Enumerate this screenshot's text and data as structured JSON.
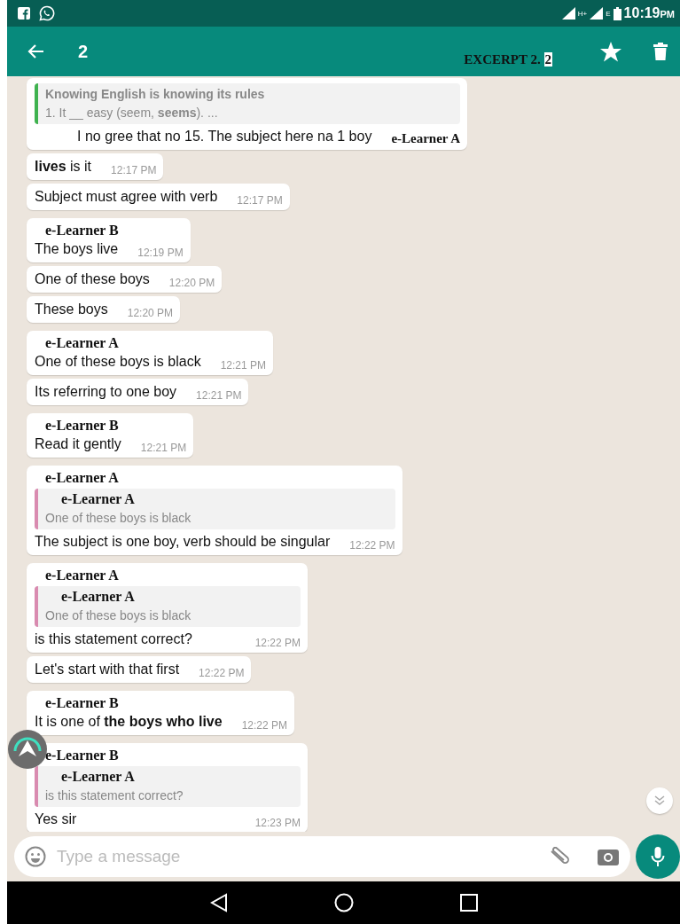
{
  "status_bar": {
    "time": "10:19",
    "time_suffix": "PM",
    "network_1": "H+",
    "network_2": "E"
  },
  "app_bar": {
    "title": "2",
    "annotation": "EXCERPT 2.",
    "annotation_highlight": "2"
  },
  "messages": [
    {
      "quote": {
        "kind": "original",
        "title": "Knowing English is knowing its rules",
        "text": "1. It __ easy (seem, **seems**). ...",
        "color": "#3fb24f"
      },
      "text": "I no gree that no 15. The subject here na 1 boy",
      "annotation": "e-Learner A"
    },
    {
      "text": "**lives** is it",
      "time": "12:17 PM"
    },
    {
      "text": "Subject must agree with verb",
      "time": "12:17 PM"
    },
    {
      "sender": "e-Learner B",
      "text": "The boys live",
      "time": "12:19 PM"
    },
    {
      "text": "One of these boys",
      "time": "12:20 PM"
    },
    {
      "text": "These boys",
      "time": "12:20 PM"
    },
    {
      "sender": "e-Learner A",
      "text": "One of these boys is black",
      "time": "12:21 PM"
    },
    {
      "text": "Its referring to one boy",
      "time": "12:21 PM"
    },
    {
      "sender": "e-Learner B",
      "text": "Read it gently",
      "time": "12:21 PM"
    },
    {
      "sender": "e-Learner A",
      "quote": {
        "kind": "annotated",
        "title": "e-Learner A",
        "text": "One of these boys is black",
        "color": "#d98bb0"
      },
      "text": "The subject is one boy, verb should be singular",
      "time": "12:22 PM"
    },
    {
      "sender": "e-Learner A",
      "quote": {
        "kind": "annotated",
        "title": "e-Learner A",
        "text": "One of these boys is black",
        "color": "#d98bb0"
      },
      "text": "is this statement correct?",
      "time": "12:22 PM"
    },
    {
      "text": "Let's start with that first",
      "time": "12:22 PM"
    },
    {
      "sender": "e-Learner B",
      "text": "It is one of **the boys who live**",
      "time": "12:22 PM"
    },
    {
      "sender": "e-Learner B",
      "quote": {
        "kind": "annotated",
        "title": "e-Learner A",
        "text": "is this statement correct?",
        "color": "#d98bb0"
      },
      "text": "Yes sir",
      "time": "12:23 PM"
    }
  ],
  "composer": {
    "placeholder": "Type a message"
  }
}
